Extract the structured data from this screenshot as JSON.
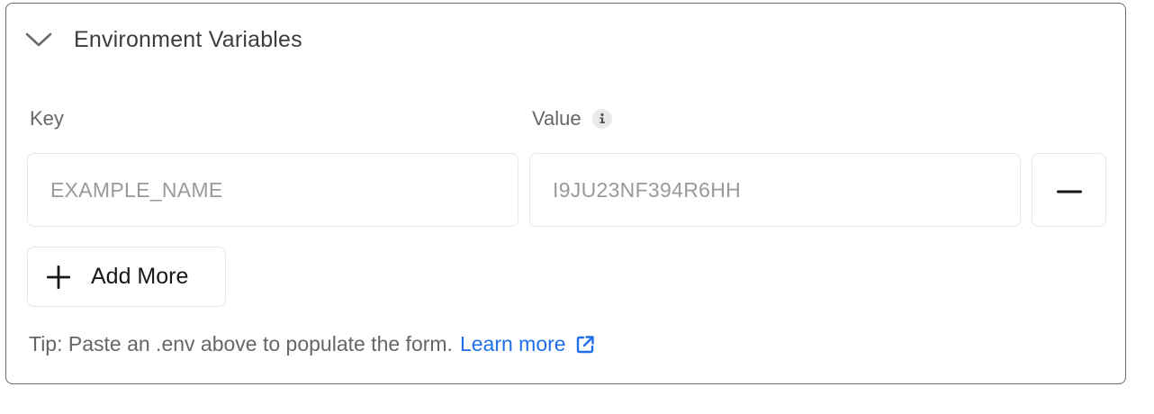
{
  "section": {
    "title": "Environment Variables",
    "collapse_icon": "chevron-down-icon"
  },
  "fields": {
    "key_label": "Key",
    "value_label": "Value",
    "value_info_icon": "info-icon",
    "rows": [
      {
        "key_placeholder": "EXAMPLE_NAME",
        "key_value": "",
        "value_placeholder": "I9JU23NF394R6HH",
        "value_value": "",
        "remove_icon": "minus-icon"
      }
    ]
  },
  "add_button": {
    "label": "Add More",
    "icon": "plus-icon"
  },
  "tip": {
    "text": "Tip: Paste an .env above to populate the form.",
    "link_label": "Learn more",
    "link_icon": "external-link-icon"
  },
  "colors": {
    "border": "#6b6b6b",
    "input_border": "#e6e6e6",
    "muted_text": "#666666",
    "placeholder": "#9a9a9a",
    "link": "#1f6feb"
  }
}
